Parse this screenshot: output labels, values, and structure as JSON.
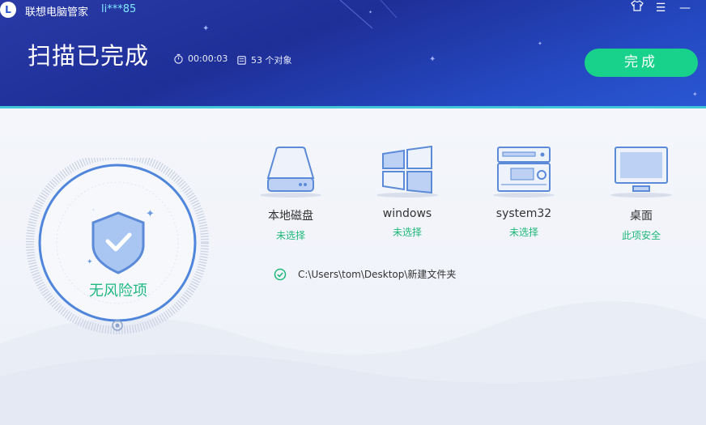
{
  "app": {
    "title": "联想电脑管家",
    "user": "li***85",
    "logo_letter": "L"
  },
  "window_buttons": {
    "skin": "shirt-icon",
    "menu": "☰",
    "minimize": "—"
  },
  "scan": {
    "title": "扫描已完成",
    "elapsed": "00:00:03",
    "objects": "53 个对象",
    "done_label": "完成"
  },
  "gauge": {
    "result": "无风险项"
  },
  "locations": [
    {
      "name": "本地磁盘",
      "status": "未选择",
      "icon": "disk-icon"
    },
    {
      "name": "windows",
      "status": "未选择",
      "icon": "windows-icon"
    },
    {
      "name": "system32",
      "status": "未选择",
      "icon": "system-device-icon"
    },
    {
      "name": "桌面",
      "status": "此项安全",
      "icon": "desktop-monitor-icon"
    }
  ],
  "scanned_path": "C:\\Users\\tom\\Desktop\\新建文件夹",
  "colors": {
    "accent_green": "#18d18a",
    "header_blue": "#2438a8",
    "icon_blue": "#5b8ad8"
  }
}
